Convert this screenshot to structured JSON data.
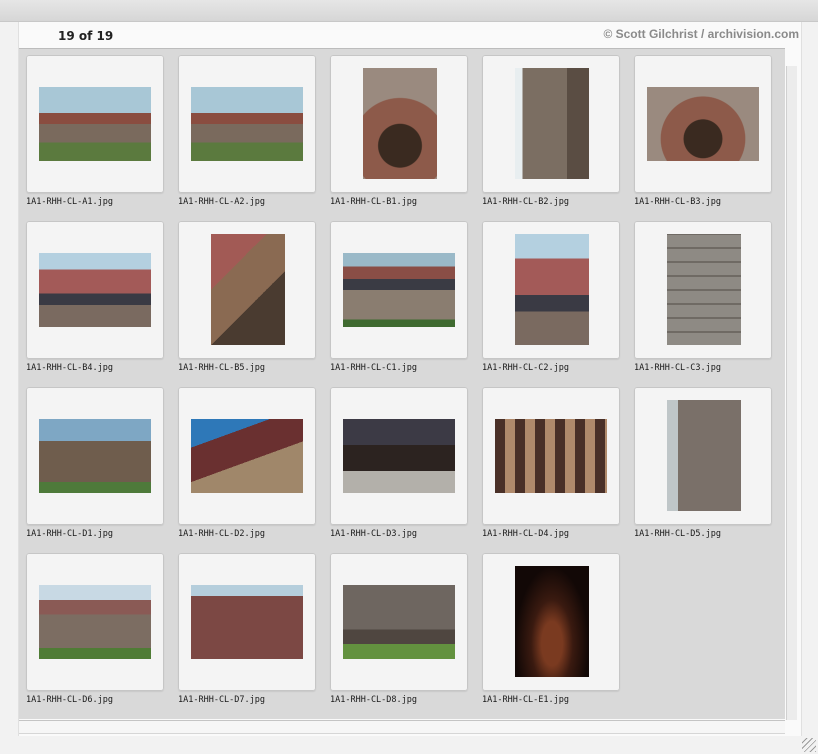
{
  "header": {
    "count": "19 of 19",
    "credit": "© Scott Gilchrist / archivision.com"
  },
  "images": [
    {
      "name": "1A1-RHH-CL-A1.jpg",
      "style": "ph-sky-building",
      "orient": "landscape"
    },
    {
      "name": "1A1-RHH-CL-A2.jpg",
      "style": "ph-sky-building",
      "orient": "landscape"
    },
    {
      "name": "1A1-RHH-CL-B1.jpg",
      "style": "ph-arch",
      "orient": "portrait"
    },
    {
      "name": "1A1-RHH-CL-B2.jpg",
      "style": "ph-tower",
      "orient": "portrait"
    },
    {
      "name": "1A1-RHH-CL-B3.jpg",
      "style": "ph-arch",
      "orient": "landscape"
    },
    {
      "name": "1A1-RHH-CL-B4.jpg",
      "style": "ph-roof",
      "orient": "landscape"
    },
    {
      "name": "1A1-RHH-CL-B5.jpg",
      "style": "ph-detail",
      "orient": "portrait"
    },
    {
      "name": "1A1-RHH-CL-C1.jpg",
      "style": "ph-wide",
      "orient": "landscape"
    },
    {
      "name": "1A1-RHH-CL-C2.jpg",
      "style": "ph-roof",
      "orient": "portrait"
    },
    {
      "name": "1A1-RHH-CL-C3.jpg",
      "style": "ph-stone",
      "orient": "portrait"
    },
    {
      "name": "1A1-RHH-CL-D1.jpg",
      "style": "ph-gable",
      "orient": "landscape"
    },
    {
      "name": "1A1-RHH-CL-D2.jpg",
      "style": "ph-roofedge",
      "orient": "landscape"
    },
    {
      "name": "1A1-RHH-CL-D3.jpg",
      "style": "ph-beam",
      "orient": "landscape"
    },
    {
      "name": "1A1-RHH-CL-D4.jpg",
      "style": "ph-window",
      "orient": "landscape"
    },
    {
      "name": "1A1-RHH-CL-D5.jpg",
      "style": "ph-corner",
      "orient": "portrait"
    },
    {
      "name": "1A1-RHH-CL-D6.jpg",
      "style": "ph-side",
      "orient": "landscape"
    },
    {
      "name": "1A1-RHH-CL-D7.jpg",
      "style": "ph-wall",
      "orient": "landscape"
    },
    {
      "name": "1A1-RHH-CL-D8.jpg",
      "style": "ph-base",
      "orient": "landscape"
    },
    {
      "name": "1A1-RHH-CL-E1.jpg",
      "style": "ph-interior",
      "orient": "portrait"
    }
  ]
}
